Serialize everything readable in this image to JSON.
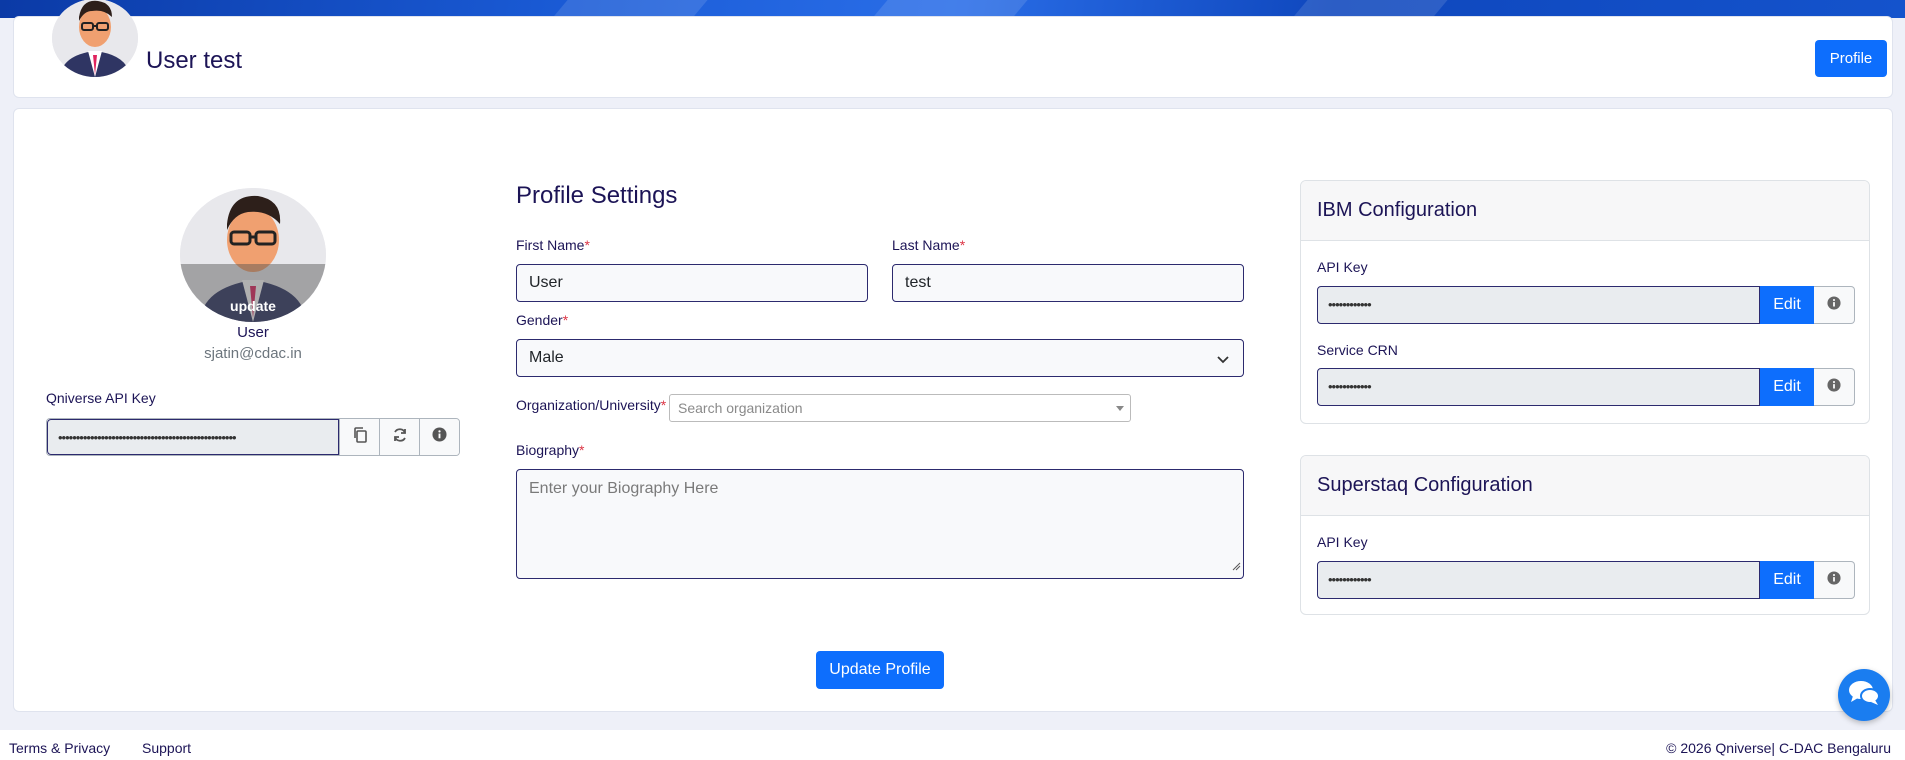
{
  "header": {
    "title": "User test",
    "profile_button": "Profile"
  },
  "user": {
    "avatar_overlay": "update",
    "name": "User",
    "email": "sjatin@cdac.in",
    "api_key_label": "Qniverse API Key",
    "api_key_value": "••••••••••••••••••••••••••••••••••••••••••••••••••"
  },
  "profile_settings": {
    "title": "Profile Settings",
    "first_name_label": "First Name",
    "first_name_value": "User",
    "last_name_label": "Last Name",
    "last_name_value": "test",
    "gender_label": "Gender",
    "gender_value": "Male",
    "organization_label": "Organization/University",
    "organization_placeholder": "Search organization",
    "biography_label": "Biography",
    "biography_placeholder": "Enter your Biography Here",
    "required_mark": "*",
    "update_button": "Update Profile"
  },
  "ibm": {
    "title": "IBM Configuration",
    "api_key_label": "API Key",
    "api_key_value": "••••••••••••",
    "service_crn_label": "Service CRN",
    "service_crn_value": "••••••••••••",
    "edit_label": "Edit"
  },
  "superstaq": {
    "title": "Superstaq Configuration",
    "api_key_label": "API Key",
    "api_key_value": "••••••••••••",
    "edit_label": "Edit"
  },
  "footer": {
    "terms": "Terms & Privacy",
    "support": "Support",
    "copyright": "© 2026 Qniverse| C-DAC Bengaluru"
  },
  "colors": {
    "primary": "#0d6efd",
    "text": "#1c1456",
    "required": "#dc3545"
  }
}
